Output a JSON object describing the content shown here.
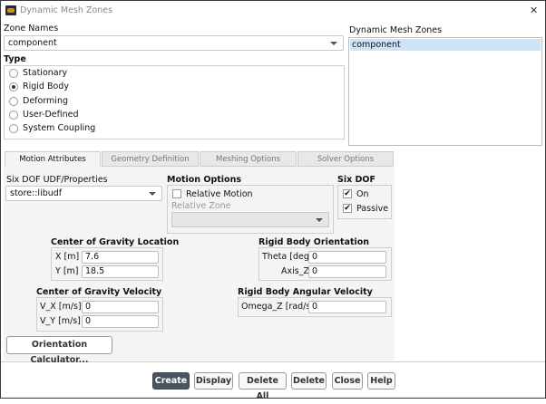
{
  "window": {
    "title": "Dynamic Mesh Zones",
    "close": "✕"
  },
  "zone_names": {
    "label": "Zone Names",
    "value": "component"
  },
  "type": {
    "label": "Type",
    "options": [
      "Stationary",
      "Rigid Body",
      "Deforming",
      "User-Defined",
      "System Coupling"
    ],
    "selected": "Rigid Body"
  },
  "mesh_zones": {
    "label": "Dynamic Mesh Zones",
    "items": [
      "component"
    ],
    "selected": "component"
  },
  "tabs": [
    "Motion Attributes",
    "Geometry Definition",
    "Meshing Options",
    "Solver Options"
  ],
  "motion": {
    "udf_label": "Six DOF UDF/Properties",
    "udf_value": "store::libudf",
    "options_label": "Motion Options",
    "relative_motion": "Relative Motion",
    "relative_motion_checked": false,
    "relative_zone_label": "Relative Zone",
    "sixdof_label": "Six DOF",
    "on": "On",
    "on_checked": true,
    "passive": "Passive",
    "passive_checked": true,
    "cog_loc_label": "Center of Gravity Location",
    "x_label": "X [m]",
    "x_value": "7.6",
    "y_label": "Y [m]",
    "y_value": "18.5",
    "orient_label": "Rigid Body Orientation",
    "theta_label": "Theta [deg]",
    "theta_value": "0",
    "axis_label": "Axis_Z",
    "axis_value": "0",
    "cog_vel_label": "Center of Gravity Velocity",
    "vx_label": "V_X [m/s]",
    "vx_value": "0",
    "vy_label": "V_Y [m/s]",
    "vy_value": "0",
    "ang_label": "Rigid Body Angular Velocity",
    "omega_label": "Omega_Z [rad/s]",
    "omega_value": "0",
    "calc_button": "Orientation Calculator..."
  },
  "buttons": {
    "create": "Create",
    "display": "Display",
    "delete_all": "Delete All",
    "delete": "Delete",
    "close": "Close",
    "help": "Help"
  },
  "colors": {
    "primary_button": "#4a5563",
    "list_selection": "#cde3f7"
  }
}
